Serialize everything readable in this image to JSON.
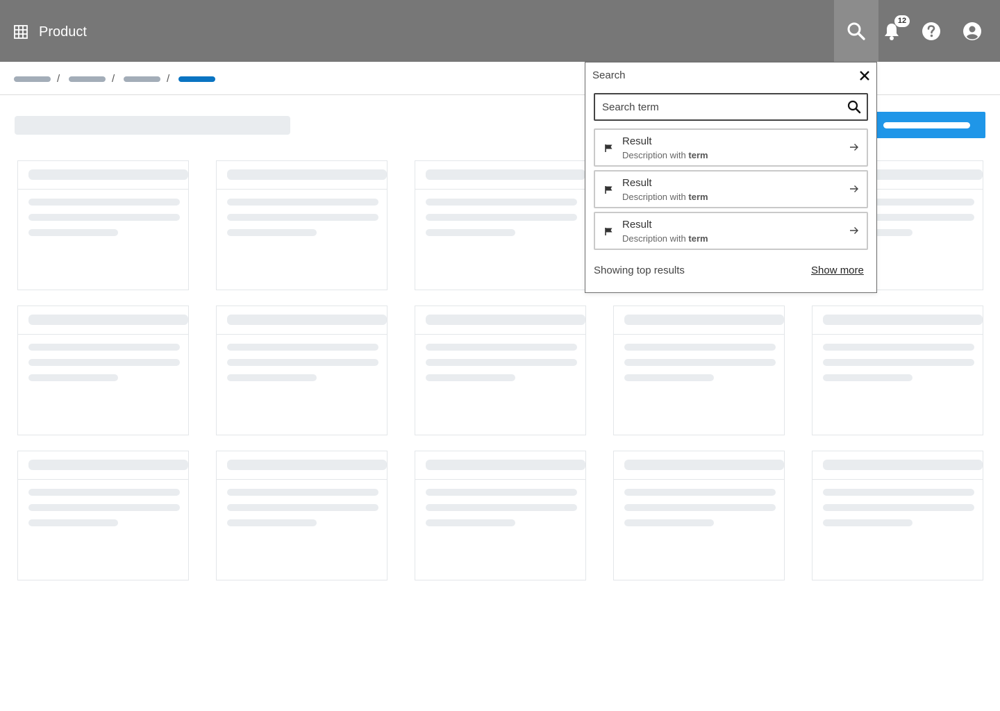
{
  "header": {
    "product_name": "Product",
    "icons": [
      "grid-icon",
      "search-icon",
      "bell-icon",
      "help-icon",
      "user-icon"
    ],
    "notification_count": "12",
    "colors": {
      "background": "#777777",
      "active_search": "#8c8c8c"
    }
  },
  "breadcrumb": {
    "separators": [
      "/",
      "/",
      "/"
    ]
  },
  "primary_button": {
    "color": "#1f96e8"
  },
  "search_panel": {
    "title": "Search",
    "input_placeholder": "Search term",
    "results": [
      {
        "title": "Result",
        "description_prefix": "Description with",
        "highlight": "term"
      },
      {
        "title": "Result",
        "description_prefix": "Description with",
        "highlight": "term"
      },
      {
        "title": "Result",
        "description_prefix": "Description with",
        "highlight": "term"
      }
    ],
    "footer_text": "Showing top results",
    "show_more_label": "Show more"
  }
}
